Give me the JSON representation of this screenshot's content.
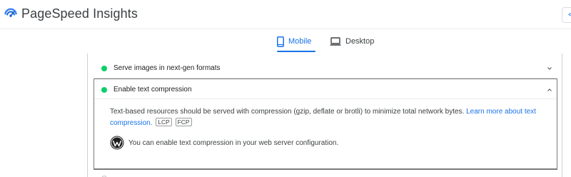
{
  "app": {
    "title": "PageSpeed Insights",
    "icon": "pagespeed-logo-icon",
    "accent_color": "#1a73e8"
  },
  "tabs": [
    {
      "label": "Mobile",
      "icon": "phone-icon",
      "selected": true
    },
    {
      "label": "Desktop",
      "icon": "laptop-icon",
      "selected": false
    }
  ],
  "audits": {
    "collapsed_item": {
      "title": "Serve images in next-gen formats",
      "status_color": "#0cce6b",
      "icon": "chevron-down-icon"
    },
    "expanded_item": {
      "title": "Enable text compression",
      "status_color": "#0cce6b",
      "icon": "chevron-up-icon",
      "description": "Text-based resources should be served with compression (gzip, deflate or brotli) to minimize total network bytes.",
      "link_text": "Learn more about text compression.",
      "metric_tags": [
        "LCP",
        "FCP"
      ],
      "platform_icon": "wordpress-icon",
      "platform_tip": "You can enable text compression in your web server configuration."
    }
  }
}
